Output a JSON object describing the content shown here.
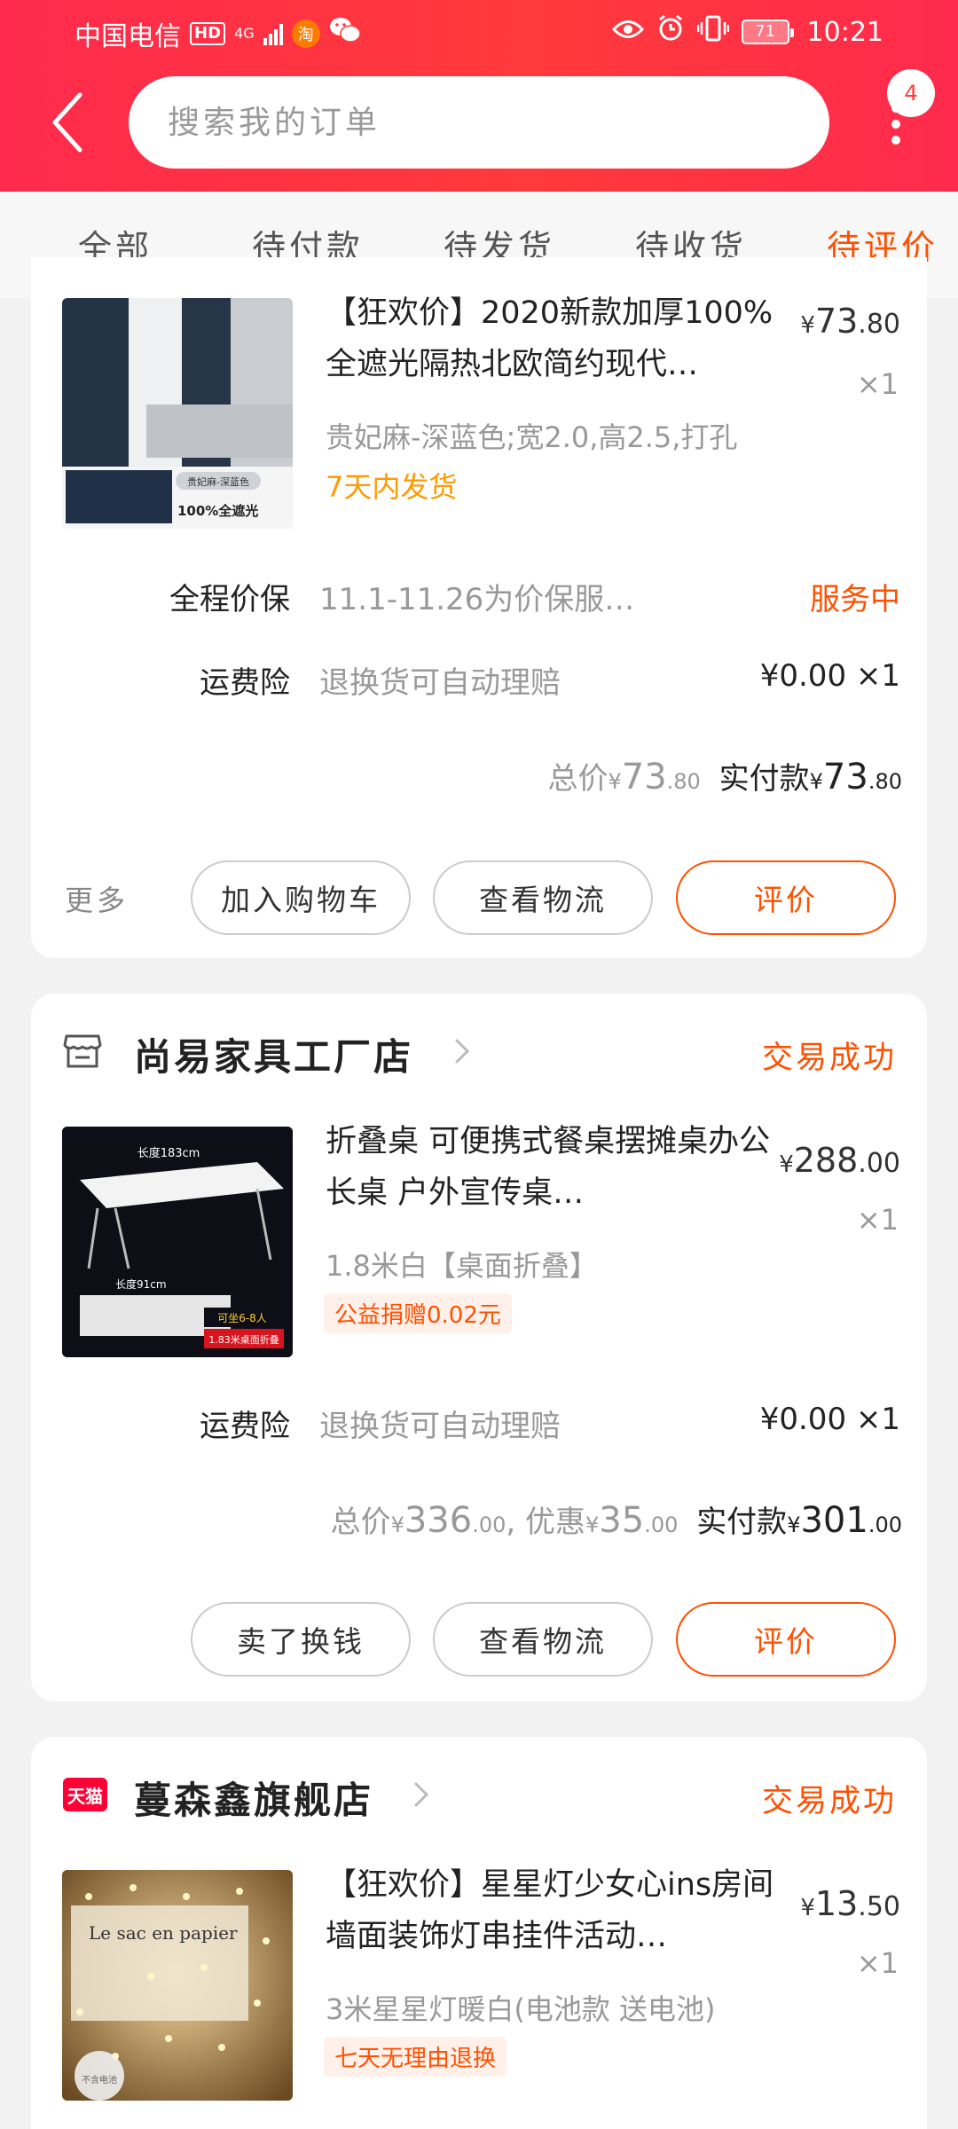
{
  "status_bar": {
    "carrier": "中国电信",
    "hd": "HD",
    "network": "4G",
    "app_icon_taobao": "淘",
    "battery": "71",
    "time": "10:21"
  },
  "header": {
    "search_placeholder": "搜索我的订单",
    "notification_count": "4"
  },
  "tabs": [
    {
      "label": "全部"
    },
    {
      "label": "待付款"
    },
    {
      "label": "待发货"
    },
    {
      "label": "待收货"
    },
    {
      "label": "待评价"
    }
  ],
  "active_tab": "待评价",
  "orders": [
    {
      "item": {
        "title": "【狂欢价】2020新款加厚100%全遮光隔热北欧简约现代…",
        "sku": "贵妃麻-深蓝色;宽2.0,高2.5,打孔",
        "tag": "7天内发货",
        "price_main": "73",
        "price_cents": ".80",
        "qty": "×1",
        "thumb_caption_top": "贵妃麻-深蓝色",
        "thumb_caption_bottom": "100%全遮光"
      },
      "services": [
        {
          "label": "全程价保",
          "desc": "11.1-11.26为价保服…",
          "right": "服务中"
        },
        {
          "label": "运费险",
          "desc": "退换货可自动理赔",
          "right": "¥0.00 ×1"
        }
      ],
      "totals": {
        "total_label": "总价",
        "total_main": "73",
        "total_cents": ".80",
        "paid_label": "实付款",
        "paid_main": "73",
        "paid_cents": ".80"
      },
      "more_label": "更多",
      "actions": [
        "加入购物车",
        "查看物流",
        "评价"
      ]
    },
    {
      "shop_name": "尚易家具工厂店",
      "status": "交易成功",
      "item": {
        "title": "折叠桌 可便携式餐桌摆摊桌办公长桌 户外宣传桌…",
        "sku": "1.8米白【桌面折叠】",
        "tag": "公益捐赠0.02元",
        "price_main": "288",
        "price_cents": ".00",
        "qty": "×1",
        "thumb_caption_top": "长度183cm",
        "thumb_caption_mid": "长度91cm",
        "thumb_caption_badge": "可坐6-8人",
        "thumb_caption_bottom": "1.83米桌面折叠"
      },
      "services": [
        {
          "label": "运费险",
          "desc": "退换货可自动理赔",
          "right": "¥0.00 ×1"
        }
      ],
      "totals": {
        "total_label": "总价",
        "total_main": "336",
        "total_cents": ".00",
        "discount_label": "优惠",
        "discount_main": "35",
        "discount_cents": ".00",
        "paid_label": "实付款",
        "paid_main": "301",
        "paid_cents": ".00"
      },
      "actions": [
        "卖了换钱",
        "查看物流",
        "评价"
      ]
    },
    {
      "shop_badge": "天猫",
      "shop_name": "蔓森鑫旗舰店",
      "status": "交易成功",
      "item": {
        "title": "【狂欢价】星星灯少女心ins房间墙面装饰灯串挂件活动…",
        "sku": "3米星星灯暖白(电池款 送电池)",
        "tag": "七天无理由退换",
        "price_main": "13",
        "price_cents": ".50",
        "qty": "×1",
        "thumb_caption": "Le sac en papier",
        "thumb_caption_bottom": "不含电池"
      }
    }
  ],
  "currency": "¥",
  "colors": {
    "brand_red": "#ff2a4d",
    "accent_orange": "#ff5000",
    "tag_yellow": "#ff9a00",
    "tmall_red": "#ff0036"
  }
}
